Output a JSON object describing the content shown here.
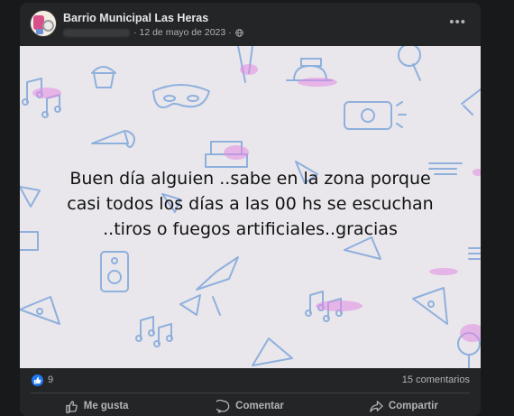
{
  "post": {
    "page_name": "Barrio Municipal Las Heras",
    "date": "12 de mayo de 2023",
    "separator": "·",
    "more_label": "•••",
    "image_text": [
      "Buen día alguien ..sabe en la zona porque",
      "casi todos los días a las 00 hs se escuchan",
      "..tiros o fuegos artificiales..gracias"
    ]
  },
  "stats": {
    "likes": "9",
    "comments": "15 comentarios"
  },
  "actions": {
    "like": "Me gusta",
    "comment": "Comentar",
    "share": "Compartir"
  },
  "icons": {
    "avatar": "page-logo-icon",
    "visibility": "globe-icon",
    "reaction": "like-reaction-icon"
  },
  "colors": {
    "card_bg": "#242526",
    "image_bg": "#e9e7ec",
    "accent_blue": "#2078f4",
    "doodle_blue": "#8fb0dc",
    "doodle_pink": "#e38be3"
  }
}
